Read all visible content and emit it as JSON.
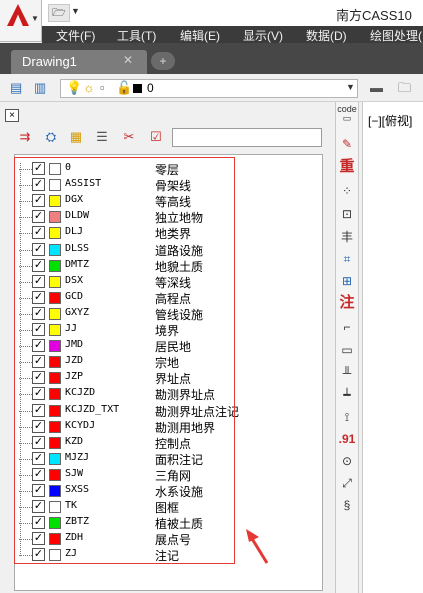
{
  "title": "南方CASS10",
  "menu": [
    "文件(F)",
    "工具(T)",
    "编辑(E)",
    "显示(V)",
    "数据(D)",
    "绘图处理("
  ],
  "tab": {
    "label": "Drawing1",
    "close": "✕"
  },
  "layer_toolbar": {
    "current_layer": "0"
  },
  "viewport_label": "[−][俯视]",
  "right_palette": [
    "code",
    "重",
    "注",
    ".91"
  ],
  "accent": "#e53935",
  "layers": [
    {
      "name": "0",
      "desc": "零层",
      "color": "#ffffff"
    },
    {
      "name": "ASSIST",
      "desc": "骨架线",
      "color": "#ffffff"
    },
    {
      "name": "DGX",
      "desc": "等高线",
      "color": "#ffff00"
    },
    {
      "name": "DLDW",
      "desc": "独立地物",
      "color": "#f08080"
    },
    {
      "name": "DLJ",
      "desc": "地类界",
      "color": "#ffff00"
    },
    {
      "name": "DLSS",
      "desc": "道路设施",
      "color": "#00e5ff"
    },
    {
      "name": "DMTZ",
      "desc": "地貌土质",
      "color": "#00e000"
    },
    {
      "name": "DSX",
      "desc": "等深线",
      "color": "#ffff00"
    },
    {
      "name": "GCD",
      "desc": "高程点",
      "color": "#ff0000"
    },
    {
      "name": "GXYZ",
      "desc": "管线设施",
      "color": "#ffff00"
    },
    {
      "name": "JJ",
      "desc": "境界",
      "color": "#ffff00"
    },
    {
      "name": "JMD",
      "desc": "居民地",
      "color": "#e000e0"
    },
    {
      "name": "JZD",
      "desc": "宗地",
      "color": "#ff0000"
    },
    {
      "name": "JZP",
      "desc": "界址点",
      "color": "#ff0000"
    },
    {
      "name": "KCJZD",
      "desc": "勘测界址点",
      "color": "#ff0000"
    },
    {
      "name": "KCJZD_TXT",
      "desc": "勘测界址点注记",
      "color": "#ff0000"
    },
    {
      "name": "KCYDJ",
      "desc": "勘测用地界",
      "color": "#ff0000"
    },
    {
      "name": "KZD",
      "desc": "控制点",
      "color": "#ff0000"
    },
    {
      "name": "MJZJ",
      "desc": "面积注记",
      "color": "#00e5ff"
    },
    {
      "name": "SJW",
      "desc": "三角网",
      "color": "#ff0000"
    },
    {
      "name": "SXSS",
      "desc": "水系设施",
      "color": "#0000ff"
    },
    {
      "name": "TK",
      "desc": "图框",
      "color": "#ffffff"
    },
    {
      "name": "ZBTZ",
      "desc": "植被土质",
      "color": "#00e000"
    },
    {
      "name": "ZDH",
      "desc": "展点号",
      "color": "#ff0000"
    },
    {
      "name": "ZJ",
      "desc": "注记",
      "color": "#ffffff"
    }
  ]
}
